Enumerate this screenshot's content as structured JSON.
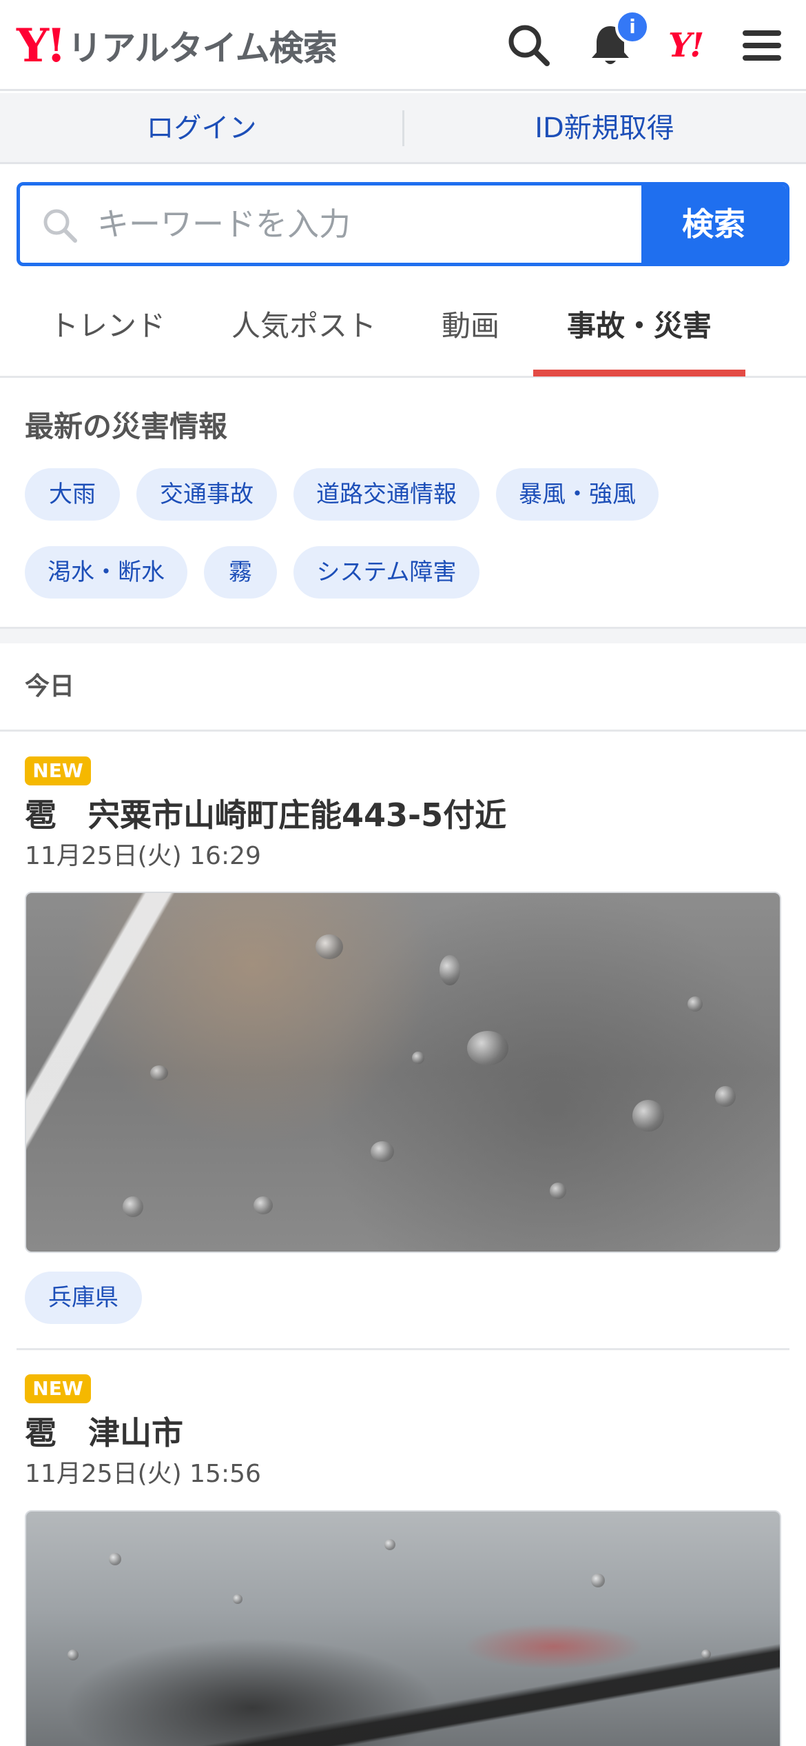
{
  "header": {
    "logo_mark": "Y!",
    "logo_text": "リアルタイム検索",
    "notification_badge": "i",
    "yj_mark": "Y!",
    "icons": [
      "search-icon",
      "bell-icon",
      "yahoo-japan-icon",
      "menu-icon"
    ]
  },
  "account": {
    "login_label": "ログイン",
    "signup_label": "ID新規取得"
  },
  "search": {
    "placeholder": "キーワードを入力",
    "value": "",
    "button_label": "検索"
  },
  "tabs": [
    {
      "label": "トレンド",
      "active": false
    },
    {
      "label": "人気ポスト",
      "active": false
    },
    {
      "label": "動画",
      "active": false
    },
    {
      "label": "事故・災害",
      "active": true
    }
  ],
  "disaster_info": {
    "title": "最新の災害情報",
    "chips": [
      "大雨",
      "交通事故",
      "道路交通情報",
      "暴風・強風",
      "渇水・断水",
      "霧",
      "システム障害"
    ]
  },
  "feed": {
    "section_label": "今日",
    "posts": [
      {
        "badge": "NEW",
        "title": "雹　宍粟市山崎町庄能443-5付近",
        "datetime": "11月25日(火) 16:29",
        "location_chip": "兵庫県"
      },
      {
        "badge": "NEW",
        "title": "雹　津山市",
        "datetime": "11月25日(火) 15:56"
      }
    ]
  },
  "colors": {
    "brand_red": "#ff0033",
    "accent_blue": "#1f6fef",
    "link_blue": "#1d4fb8",
    "tab_underline": "#e34b45",
    "new_badge": "#f5b800",
    "chip_bg": "#e6eefc"
  }
}
